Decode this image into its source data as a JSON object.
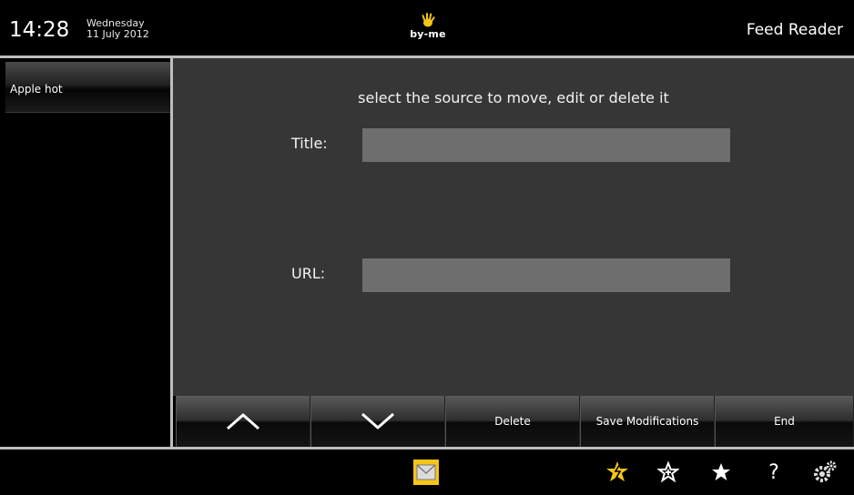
{
  "header": {
    "time": "14:28",
    "weekday": "Wednesday",
    "date": "11 July 2012",
    "logo_text": "by-me",
    "app_title": "Feed Reader"
  },
  "sidebar": {
    "items": [
      {
        "label": "Apple hot"
      }
    ]
  },
  "main": {
    "instruction": "select the source to move, edit or delete it",
    "title_label": "Title:",
    "title_value": "",
    "url_label": "URL:",
    "url_value": ""
  },
  "buttons": {
    "up_icon": "chevron-up-icon",
    "down_icon": "chevron-down-icon",
    "delete_label": "Delete",
    "save_label": "Save Modifications",
    "end_label": "End"
  },
  "bottom_bar": {
    "icons": [
      "message-icon",
      "star-lightning-icon",
      "star-outline-icon",
      "star-filled-icon",
      "help-icon",
      "settings-gears-icon"
    ]
  },
  "colors": {
    "accent": "#f5c518",
    "panel_bg": "#363636",
    "input_bg": "#6e6e6e"
  }
}
